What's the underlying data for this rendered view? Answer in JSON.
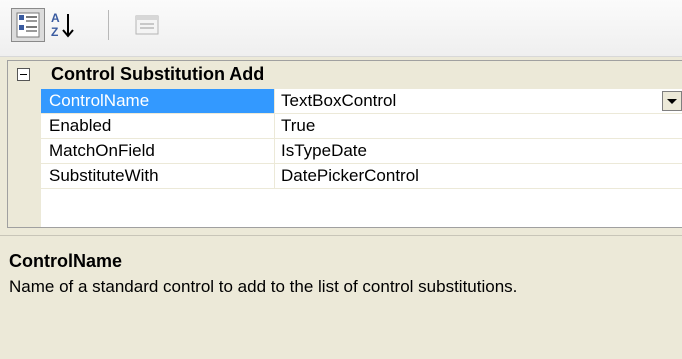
{
  "toolbar": {
    "buttons": [
      {
        "name": "categorized-view",
        "icon": "categorized-icon",
        "pressed": true
      },
      {
        "name": "alphabetical-sort",
        "icon": "sort-az-icon",
        "pressed": false
      },
      {
        "name": "property-pages",
        "icon": "property-pages-icon",
        "pressed": false,
        "disabled": true
      }
    ]
  },
  "grid": {
    "category": "Control Substitution Add",
    "properties": [
      {
        "name": "ControlName",
        "value": "TextBoxControl"
      },
      {
        "name": "Enabled",
        "value": "True"
      },
      {
        "name": "MatchOnField",
        "value": "IsTypeDate"
      },
      {
        "name": "SubstituteWith",
        "value": "DatePickerControl"
      }
    ]
  },
  "help": {
    "title": "ControlName",
    "description": "Name of a standard control to add to the list of control substitutions."
  },
  "colors": {
    "selection": "#3399ff",
    "panel": "#ece9d8",
    "grid_bg": "#ffffff"
  }
}
